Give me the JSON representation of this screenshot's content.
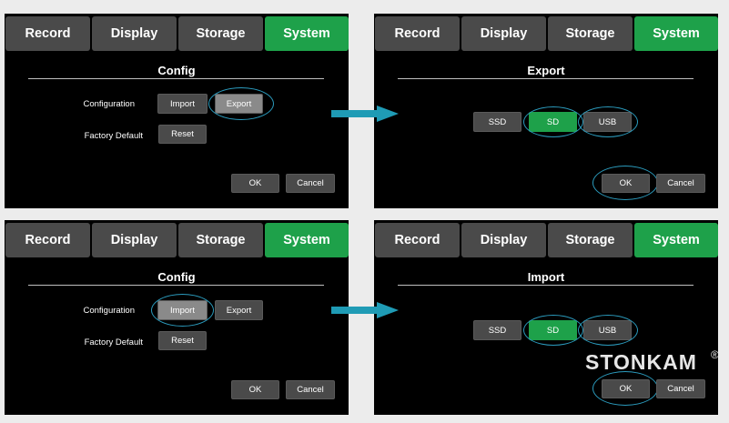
{
  "tabs": [
    "Record",
    "Display",
    "Storage",
    "System"
  ],
  "config_panel": {
    "title": "Config",
    "configuration_label": "Configuration",
    "import_label": "Import",
    "export_label": "Export",
    "factory_default_label": "Factory Default",
    "reset_label": "Reset",
    "ok_label": "OK",
    "cancel_label": "Cancel"
  },
  "export_panel": {
    "title": "Export",
    "storage_options": [
      "SSD",
      "SD",
      "USB"
    ],
    "selected": "SD",
    "ok_label": "OK",
    "cancel_label": "Cancel"
  },
  "import_panel": {
    "title": "Import",
    "storage_options": [
      "SSD",
      "SD",
      "USB"
    ],
    "selected": "SD",
    "ok_label": "OK",
    "cancel_label": "Cancel"
  },
  "brand": {
    "name": "STONKAM",
    "mark": "®"
  },
  "colors": {
    "active_tab": "#1ea14a",
    "inactive_tab": "#4a4a4a",
    "highlight_ring": "#2b9bbd",
    "arrow": "#1f9bb5"
  }
}
